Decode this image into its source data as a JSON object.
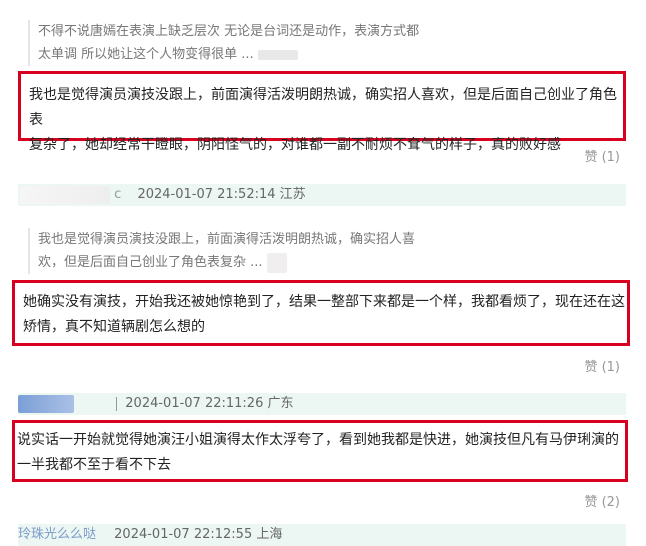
{
  "comments": [
    {
      "quote": [
        "不得不说唐嫣在表演上缺乏层次 无论是台词还是动作，表演方式都",
        "太单调 所以她让这个人物变得很单 ..."
      ],
      "body": [
        "我也是觉得演员演技没跟上，前面演得活泼明朗热诚，确实招人喜欢，但是后面自己创业了角色表",
        "复杂了，她却经常干瞪眼，阴阳怪气的，对谁都一副不耐烦不耷气的样子，真的败好感"
      ],
      "like": "赞 (1)"
    },
    {
      "meta": {
        "user": "c",
        "time": "2024-01-07 21:52:14",
        "loc": "江苏"
      },
      "quote": [
        "我也是觉得演员演技没跟上，前面演得活泼明朗热诚，确实招人喜",
        "欢，但是后面自己创业了角色表复杂 ..."
      ],
      "body": [
        "她确实没有演技，开始我还被她惊艳到了，结果一整部下来都是一个样，我都看烦了，现在还在这",
        "矫情，真不知道辆剧怎么想的"
      ],
      "like": "赞 (1)"
    },
    {
      "meta": {
        "time": "2024-01-07 22:11:26",
        "loc": "广东"
      },
      "body": [
        "说实话一开始就觉得她演汪小姐演得太作太浮夸了，看到她我都是快进，她演技但凡有马伊琍演的",
        "一半我都不至于看不下去"
      ],
      "like": "赞 (2)"
    },
    {
      "meta": {
        "user": "玲珠光么么哒",
        "time": "2024-01-07 22:12:55",
        "loc": "上海"
      }
    }
  ]
}
